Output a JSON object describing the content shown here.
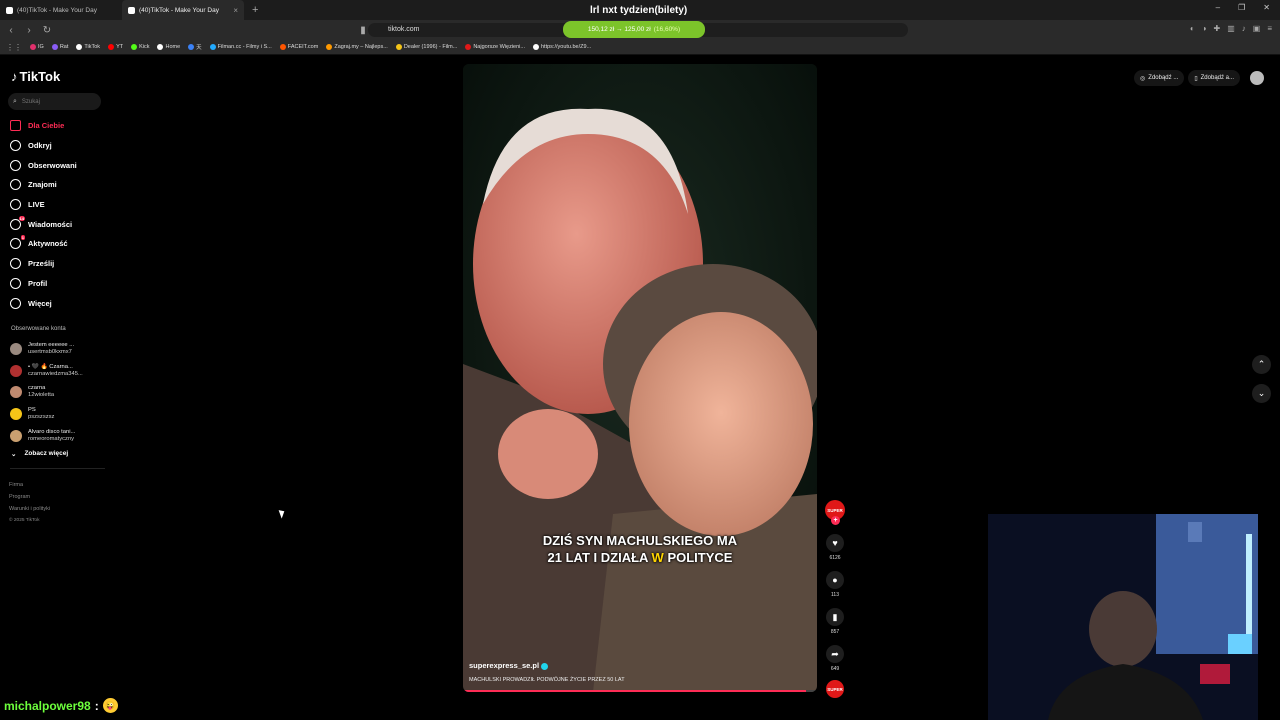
{
  "browser": {
    "tabs": [
      {
        "title": "(40)TikTok - Make Your Day",
        "active": false
      },
      {
        "title": "(40)TikTok - Make Your Day",
        "active": true
      }
    ],
    "window_title": "lrl nxt tydzien(bilety)",
    "url": "tiktok.com",
    "price_pill": {
      "text": "150,12 zł → 125,00 zł",
      "pct": "(16,60%)",
      "color": "#7cc42a"
    },
    "bookmarks": [
      {
        "label": "IG",
        "color": "#e1306c"
      },
      {
        "label": "Rat",
        "color": "#8a5cf6"
      },
      {
        "label": "TikTok",
        "color": "#ffffff"
      },
      {
        "label": "YT",
        "color": "#ff0000"
      },
      {
        "label": "Kick",
        "color": "#53fc18"
      },
      {
        "label": "Home",
        "color": "#ffffff"
      },
      {
        "label": "天",
        "color": "#3b82f6"
      },
      {
        "label": "Filman.cc - Filmy i S...",
        "color": "#22aaff"
      },
      {
        "label": "FACEIT.com",
        "color": "#ff5500"
      },
      {
        "label": "Zagraj.my – Najleps...",
        "color": "#ff9900"
      },
      {
        "label": "Dealer (1996) - Film...",
        "color": "#f5c518"
      },
      {
        "label": "Najgorsze Więzieni...",
        "color": "#e01818"
      },
      {
        "label": "https://youtu.be/Z9...",
        "color": "#ffffff"
      }
    ]
  },
  "tiktok": {
    "logo": "TikTok",
    "search_placeholder": "Szukaj",
    "nav": [
      {
        "label": "Dla Ciebie",
        "icon": "home-icon",
        "active": true
      },
      {
        "label": "Odkryj",
        "icon": "compass-icon"
      },
      {
        "label": "Obserwowani",
        "icon": "following-icon"
      },
      {
        "label": "Znajomi",
        "icon": "friends-icon"
      },
      {
        "label": "LIVE",
        "icon": "live-icon"
      },
      {
        "label": "Wiadomości",
        "icon": "message-icon",
        "badge": "14"
      },
      {
        "label": "Aktywność",
        "icon": "activity-icon",
        "badge": "1"
      },
      {
        "label": "Prześlij",
        "icon": "upload-icon"
      },
      {
        "label": "Profil",
        "icon": "profile-icon"
      },
      {
        "label": "Więcej",
        "icon": "more-icon"
      }
    ],
    "followed_label": "Obserwowane konta",
    "followed": [
      {
        "name": "Jestem eeeeee ...",
        "user": "usertmsb0kxmx7"
      },
      {
        "name": "• 🖤 🔥 Czarna...",
        "user": "czarnawiedzma345..."
      },
      {
        "name": "czarna",
        "user": "12wioletta"
      },
      {
        "name": "PS",
        "user": "pszszszsz"
      },
      {
        "name": "Alvaro disco tani...",
        "user": "romeoromatyczny"
      }
    ],
    "see_more": "Zobacz więcej",
    "footer": [
      "Firma",
      "Program",
      "Warunki i polityki"
    ],
    "copyright": "© 2025 TikTok",
    "get_buttons": [
      "Zdobądź ...",
      "Zdobądź a..."
    ],
    "video": {
      "caption_line1": "DZIŚ SYN MACHULSKIEGO MA",
      "caption_line2_a": "21 LAT I DZIAŁA ",
      "caption_line2_hl": "W",
      "caption_line2_b": " POLITYCE",
      "author": "superexpress_se.pl",
      "description": "MACHULSKI PROWADZIŁ PODWÓJNE ŻYCIE PRZEZ 50 LAT",
      "progress": 0.97
    },
    "actions": {
      "avatar_label": "SUPER",
      "likes": "6126",
      "comments": "113",
      "saves": "857",
      "shares": "649",
      "disc_label": "SUPER"
    }
  },
  "stream": {
    "chat_user": "michalpower98",
    "chat_separator": ":",
    "chat_emoji": "😜"
  }
}
